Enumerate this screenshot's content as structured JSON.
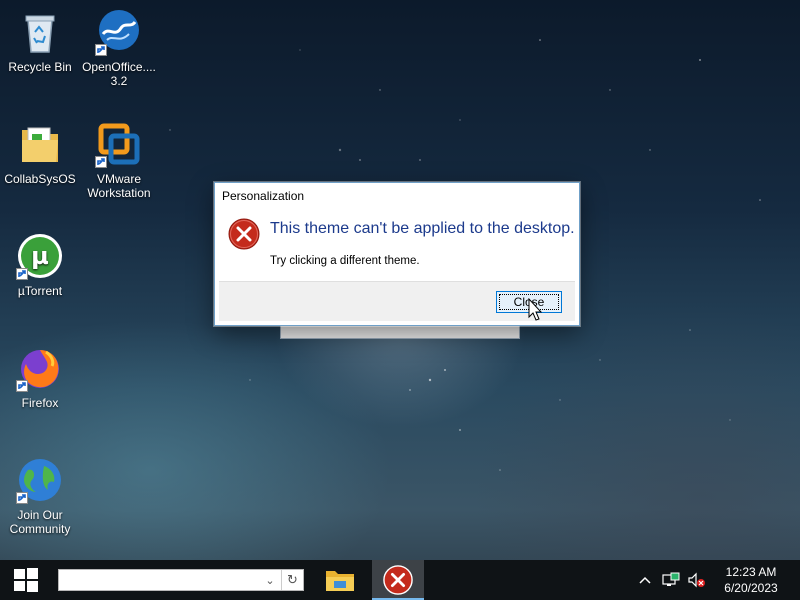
{
  "desktop": {
    "icons": [
      {
        "label": "Recycle Bin"
      },
      {
        "label": "OpenOffice.... 3.2"
      },
      {
        "label": "CollabSysOS"
      },
      {
        "label": "VMware Workstation"
      },
      {
        "label": "µTorrent"
      },
      {
        "label": "Firefox"
      },
      {
        "label": "Join Our Community"
      }
    ]
  },
  "dialog": {
    "title": "Personalization",
    "heading": "This theme can't be applied to the desktop.",
    "message": "Try clicking a different theme.",
    "close_label": "Close",
    "icon": "error-icon"
  },
  "taskbar": {
    "search_value": "",
    "search_placeholder": "",
    "items": [
      {
        "name": "file-explorer",
        "icon": "folder-icon"
      },
      {
        "name": "personalization-error",
        "icon": "error-icon"
      }
    ],
    "tray": {
      "icons": [
        "chevron-up-icon",
        "network-icon",
        "volume-muted-icon"
      ],
      "time": "12:23 AM",
      "date": "6/20/2023"
    }
  },
  "colors": {
    "heading_blue": "#1c3a8c",
    "error_red": "#d32f2f",
    "taskbar_bg": "#0f1316",
    "accent": "#0078d7"
  }
}
